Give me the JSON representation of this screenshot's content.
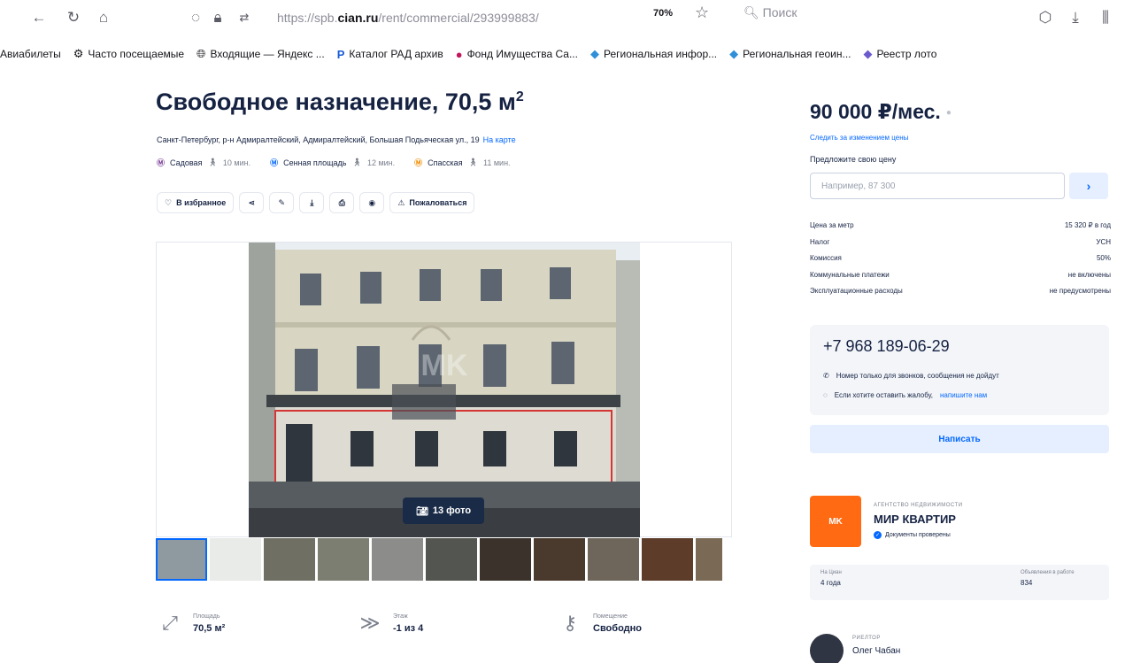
{
  "browser": {
    "url_prefix": "https://spb.",
    "url_domain": "cian.ru",
    "url_path": "/rent/commercial/293999883/",
    "zoom": "70%",
    "search_placeholder": "Поиск",
    "bookmarks": [
      {
        "label": "Авиабилеты",
        "icon": "none"
      },
      {
        "label": "Часто посещаемые",
        "icon": "gear-icon"
      },
      {
        "label": "Входящие — Яндекс ...",
        "icon": "globe-icon"
      },
      {
        "label": "Каталог РАД архив",
        "icon": "p-logo-icon"
      },
      {
        "label": "Фонд Имущества Са...",
        "icon": "fund-icon"
      },
      {
        "label": "Региональная инфор...",
        "icon": "region-icon"
      },
      {
        "label": "Региональная геоин...",
        "icon": "region-icon"
      },
      {
        "label": "Реестр лото",
        "icon": "registry-icon"
      }
    ]
  },
  "listing": {
    "title": "Свободное назначение, 70,5 м",
    "title_sup": "2",
    "address": "Санкт-Петербург, р-н Адмиралтейский, Адмиралтейский, Большая Подьяческая ул., 19",
    "map_link": "На карте",
    "metro": [
      {
        "name": "Садовая",
        "dist": "10 мин.",
        "color": "#7b3f98"
      },
      {
        "name": "Сенная площадь",
        "dist": "12 мин.",
        "color": "#0468ff"
      },
      {
        "name": "Спасская",
        "dist": "11 мин.",
        "color": "#f08c00"
      }
    ],
    "actions": {
      "favorite": "В избранное",
      "complain": "Пожаловаться"
    },
    "photo_count": "13 фото",
    "params": [
      {
        "label": "Площадь",
        "value": "70,5 м²",
        "icon": "area-icon"
      },
      {
        "label": "Этаж",
        "value": "-1 из 4",
        "icon": "floor-icon"
      },
      {
        "label": "Помещение",
        "value": "Свободно",
        "icon": "key-icon"
      }
    ]
  },
  "sidebar": {
    "price": "90 000 ₽/мес.",
    "follow_link": "Следить за изменением цены",
    "offer_label": "Предложите свою цену",
    "offer_placeholder": "Например, 87 300",
    "facts": [
      {
        "label": "Цена за метр",
        "value": "15 320 ₽ в год"
      },
      {
        "label": "Налог",
        "value": "УСН"
      },
      {
        "label": "Комиссия",
        "value": "50%"
      },
      {
        "label": "Коммунальные платежи",
        "value": "не включены"
      },
      {
        "label": "Эксплуатационные расходы",
        "value": "не предусмотрены"
      }
    ],
    "phone": "+7 968 189-06-29",
    "note_calls": "Номер только для звонков, сообщения не дойдут",
    "note_complain_text": "Если хотите оставить жалобу,",
    "note_complain_link": "напишите нам",
    "write_button": "Написать",
    "agency": {
      "type": "АГЕНТСТВО НЕДВИЖИМОСТИ",
      "name": "МИР КВАРТИР",
      "verified": "Документы проверены",
      "stat1_label": "На Циан",
      "stat1_value": "4 года",
      "stat2_label": "Объявления в работе",
      "stat2_value": "834"
    },
    "realtor": {
      "role": "РИЕЛТОР",
      "name": "Олег Чабан"
    }
  }
}
